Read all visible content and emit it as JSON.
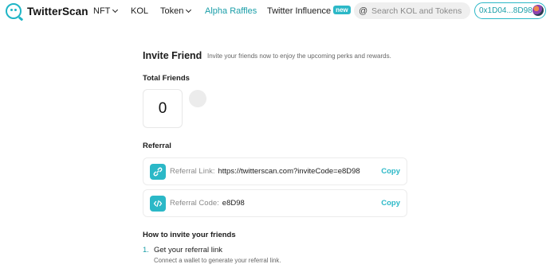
{
  "nav": {
    "brand": "TwitterScan",
    "items": [
      {
        "label": "NFT",
        "dropdown": true
      },
      {
        "label": "KOL",
        "dropdown": false
      },
      {
        "label": "Token",
        "dropdown": true
      },
      {
        "label": "Alpha Raffles",
        "dropdown": false,
        "active": true
      },
      {
        "label": "Twitter Influence",
        "dropdown": false,
        "badge": "new"
      }
    ],
    "search_placeholder": "Search KOL and Tokens",
    "search_icon": "at-icon",
    "wallet": "0x1D04...8D98"
  },
  "invite": {
    "title": "Invite Friend",
    "subtitle": "Invite your friends now to enjoy the upcoming perks and rewards."
  },
  "friends": {
    "label": "Total Friends",
    "count": "0"
  },
  "referral": {
    "label": "Referral",
    "link": {
      "icon": "link-icon",
      "label": "Referral Link:",
      "value": "https://twitterscan.com?inviteCode=e8D98",
      "copy": "Copy"
    },
    "code": {
      "icon": "code-icon",
      "label": "Referral Code:",
      "value": "e8D98",
      "copy": "Copy"
    }
  },
  "how_to": {
    "label": "How to invite your friends",
    "steps": [
      {
        "num": "1.",
        "title": "Get your referral link",
        "desc": "Connect a wallet to generate your referral link."
      }
    ]
  },
  "colors": {
    "accent": "#2bb8c7",
    "accent_text": "#1a9ea8"
  }
}
